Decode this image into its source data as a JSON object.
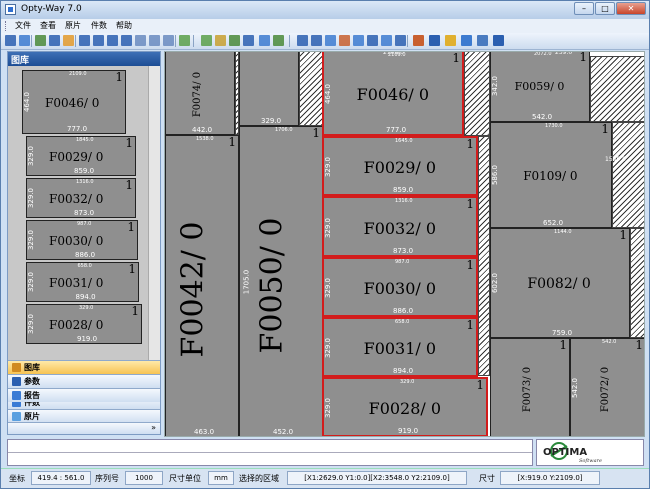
{
  "window": {
    "title": "Opty-Way 7.0"
  },
  "menu": [
    "文件",
    "查看",
    "原片",
    "件数",
    "帮助"
  ],
  "toolbar": {
    "icons": [
      "save-icon",
      "save-as-icon",
      "open-icon",
      "view-icon",
      "frame-icon",
      "first-icon",
      "prev-icon",
      "next-icon",
      "last-icon",
      "zoom-in-icon",
      "zoom-out-icon",
      "fit-icon",
      "layout-icon",
      "move-icon",
      "align-icon",
      "rotate-icon",
      "flip-icon",
      "piece-icon",
      "tool-icon",
      "cut-icon",
      "print-icon",
      "export-icon",
      "settings-icon",
      "grid-icon",
      "panel-icon",
      "report-icon",
      "optimize-icon"
    ]
  },
  "left_panel": {
    "title": "图库",
    "items": [
      {
        "name": "F0046/ 0",
        "w": "777.0",
        "h": "464.0",
        "tw": "2109.0",
        "q": "1"
      },
      {
        "name": "F0029/ 0",
        "w": "859.0",
        "h": "329.0",
        "tw": "1845.0",
        "q": "1"
      },
      {
        "name": "F0032/ 0",
        "w": "873.0",
        "h": "329.0",
        "tw": "1316.0",
        "q": "1"
      },
      {
        "name": "F0030/ 0",
        "w": "886.0",
        "h": "329.0",
        "tw": "987.0",
        "q": "1"
      },
      {
        "name": "F0031/ 0",
        "w": "894.0",
        "h": "329.0",
        "tw": "658.0",
        "q": "1"
      },
      {
        "name": "F0028/ 0",
        "w": "919.0",
        "h": "329.0",
        "tw": "329.0",
        "q": "1"
      }
    ],
    "nav": [
      "件数",
      "原片",
      "图库",
      "参数",
      "报告"
    ],
    "nav_active": "图库"
  },
  "canvas": {
    "pieces": [
      {
        "name": "F0074/ 0",
        "w": "442.0",
        "h": "",
        "q": ""
      },
      {
        "name": "",
        "w": "329.0",
        "h": "",
        "q": ""
      },
      {
        "name": "F0046/ 0",
        "w": "777.0",
        "h": "464.0",
        "q": "1",
        "top": "2109.0"
      },
      {
        "name": "F0029/ 0",
        "w": "859.0",
        "h": "329.0",
        "q": "1",
        "top": "1645.0"
      },
      {
        "name": "F0032/ 0",
        "w": "873.0",
        "h": "329.0",
        "q": "1",
        "top": "1316.0"
      },
      {
        "name": "F0030/ 0",
        "w": "886.0",
        "h": "329.0",
        "q": "1",
        "top": "987.0"
      },
      {
        "name": "F0031/ 0",
        "w": "894.0",
        "h": "329.0",
        "q": "1",
        "top": "658.0"
      },
      {
        "name": "F0028/ 0",
        "w": "919.0",
        "h": "329.0",
        "q": "1",
        "top": "329.0"
      },
      {
        "name": "F0042/ 0",
        "w": "463.0",
        "h": "",
        "q": "1",
        "top": "1538.0"
      },
      {
        "name": "F0050/ 0",
        "w": "452.0",
        "h": "1705.0",
        "q": "1",
        "top": "1706.0"
      },
      {
        "name": "F0059/ 0",
        "w": "542.0",
        "h": "342.0",
        "q": "1",
        "top": "2072.0"
      },
      {
        "name": "F0109/ 0",
        "w": "652.0",
        "h": "586.0",
        "q": "1",
        "top": "1730.0"
      },
      {
        "name": "F0082/ 0",
        "w": "759.0",
        "h": "602.0",
        "q": "1",
        "top": "1144.0"
      },
      {
        "name": "F0073/ 0",
        "w": "",
        "h": "",
        "q": "1"
      },
      {
        "name": "F0072/ 0",
        "w": "",
        "h": "542.0",
        "q": "1",
        "top": "542.0"
      }
    ],
    "misc": [
      "259.0",
      "2108.0",
      "1550.0",
      "542.0"
    ]
  },
  "logo_text": "OPTIMA",
  "logo_sub": "Software",
  "status": {
    "coord_label": "坐标",
    "coord_value": "419.4 : 561.0",
    "serial_label": "序列号",
    "serial_value": "1000",
    "unit_label": "尺寸单位",
    "unit_value": "mm",
    "area_label": "选择的区域",
    "area_value": "[X1:2629.0 Y1:0.0][X2:3548.0 Y2:2109.0]",
    "size_label": "尺寸",
    "size_value": "[X:919.0 Y:2109.0]"
  }
}
